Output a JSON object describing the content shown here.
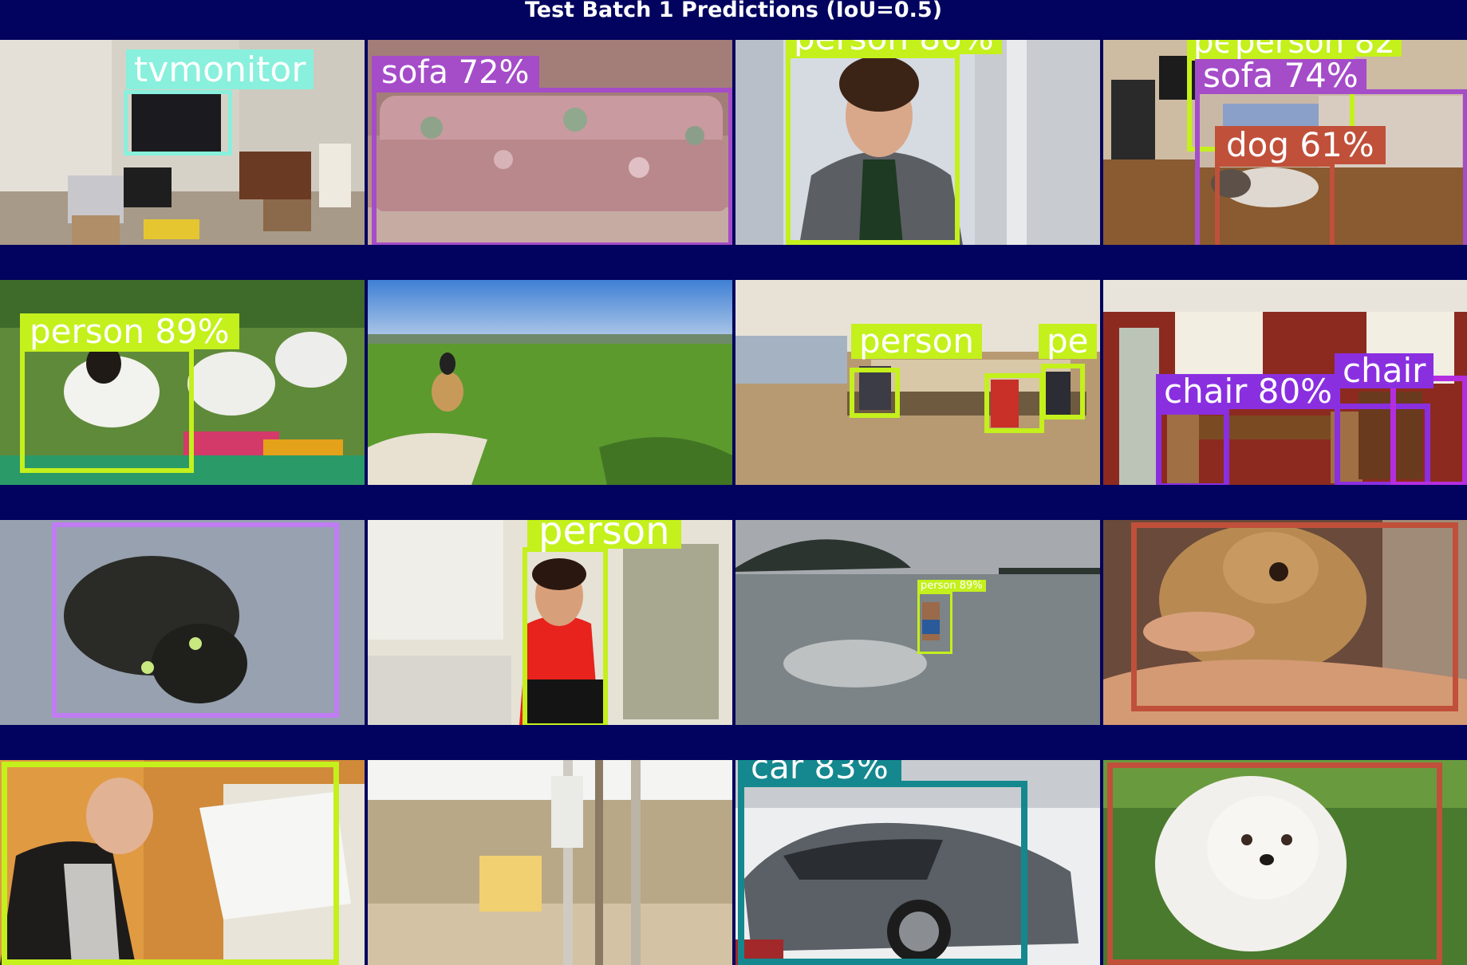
{
  "title": "Test Batch 1 Predictions (IoU=0.5)",
  "colors": {
    "background": "#02035e",
    "person": "#c4f01c",
    "sofa": "#a54cc9",
    "tvmonitor": "#88f0dc",
    "dog": "#c0503a",
    "chair": "#8a2fe0",
    "cat": "#c07cf2",
    "car": "#14888e"
  },
  "tiles": [
    {
      "scene": "cluttered room with television",
      "labels": [
        "tvmonitor"
      ]
    },
    {
      "scene": "floral sofa",
      "labels": [
        "sofa 72%"
      ]
    },
    {
      "scene": "young man with curly hair",
      "labels": [
        "person 86%"
      ]
    },
    {
      "scene": "living room with dog on sofa",
      "labels": [
        "pe",
        "person 82",
        "sofa 74%",
        "dog 61%"
      ]
    },
    {
      "scene": "children sitting on grass",
      "labels": [
        "person 89%"
      ]
    },
    {
      "scene": "horse riders in green field",
      "labels": []
    },
    {
      "scene": "office with people at desks",
      "labels": [
        "person",
        "pe"
      ]
    },
    {
      "scene": "dining room with chairs",
      "labels": [
        "chair 80%",
        "chair"
      ]
    },
    {
      "scene": "tortoiseshell cat on carpet",
      "labels": []
    },
    {
      "scene": "woman in red shirt sitting",
      "labels": [
        "person"
      ]
    },
    {
      "scene": "person running into sea",
      "labels": [
        "person 89%"
      ]
    },
    {
      "scene": "shaggy dog being held",
      "labels": []
    },
    {
      "scene": "elderly man reading paper",
      "labels": []
    },
    {
      "scene": "desert with Mojave phone booth sign",
      "labels": []
    },
    {
      "scene": "silver concept car",
      "labels": [
        "car 83%"
      ]
    },
    {
      "scene": "white fluffy dog on grass",
      "labels": []
    }
  ]
}
